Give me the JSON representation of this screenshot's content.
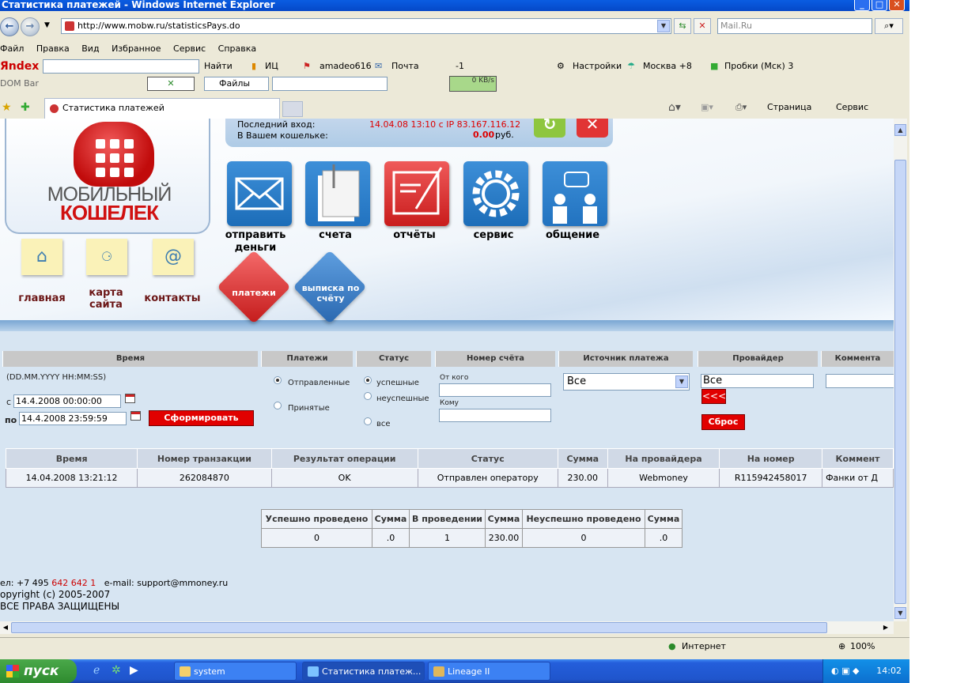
{
  "window": {
    "title": "Статистика платежей - Windows Internet Explorer"
  },
  "address": {
    "url": "http://www.mobw.ru/statisticsPays.do",
    "search_placeholder": "Mail.Ru"
  },
  "menu": [
    "Файл",
    "Правка",
    "Вид",
    "Избранное",
    "Сервис",
    "Справка"
  ],
  "toolbar1": {
    "brand": "Яndex",
    "find": "Найти",
    "ic": "ИЦ",
    "user": "amadeo616",
    "mail": "Почта",
    "minus": "-1",
    "settings": "Настройки",
    "moscow": "Москва +8",
    "traffic": "Пробки (Мск) 3"
  },
  "toolbar2": {
    "dom": "DOM Bar",
    "files": "Файлы",
    "speed": "0 KB/s"
  },
  "tab": {
    "title": "Статистика платежей"
  },
  "tabtools": {
    "page": "Страница",
    "service": "Сервис"
  },
  "login": {
    "last_label": "Последний вход:",
    "last_value": "14.04.08 13:10 с IP 83.167.116.12",
    "wallet_label": "В Вашем кошельке:",
    "balance": "0.00",
    "currency": "руб."
  },
  "logo": {
    "line1": "МОБИЛЬНЫЙ",
    "line2": "КОШЕЛЕК"
  },
  "icons": [
    {
      "label": "отправить деньги",
      "color": "#1c6db8"
    },
    {
      "label": "счета",
      "color": "#2273c0"
    },
    {
      "label": "отчёты",
      "color": "#d92e2e"
    },
    {
      "label": "сервис",
      "color": "#1c6db8"
    },
    {
      "label": "общение",
      "color": "#2273c0"
    }
  ],
  "nav": {
    "home": "главная",
    "sitemap": "карта сайта",
    "contacts": "контакты"
  },
  "diamonds": {
    "payments": "платежи",
    "statement": "выписка по счёту"
  },
  "filter": {
    "headers": [
      "Время",
      "Платежи",
      "Статус",
      "Номер счёта",
      "Источник платежа",
      "Провайдер",
      "Коммента"
    ],
    "format": "(DD.MM.YYYY HH:MM:SS)",
    "from_label": "с",
    "from": "14.4.2008 00:00:00",
    "to_label": "по",
    "to": "14.4.2008 23:59:59",
    "generate": "Сформировать",
    "payments": [
      "Отправленные",
      "Принятые"
    ],
    "status": [
      "успешные",
      "неуспешные",
      "все"
    ],
    "from_whom": "От кого",
    "to_whom": "Кому",
    "source": "Все",
    "provider": "Все",
    "back": "<<<",
    "reset": "Сброс"
  },
  "results": {
    "headers": [
      "Время",
      "Номер транзакции",
      "Результат операции",
      "Статус",
      "Сумма",
      "На провайдера",
      "На номер",
      "Коммент"
    ],
    "rows": [
      [
        "14.04.2008 13:21:12",
        "262084870",
        "OK",
        "Отправлен оператору",
        "230.00",
        "Webmoney",
        "R115942458017",
        "Фанки от Д"
      ]
    ]
  },
  "summary": {
    "headers": [
      "Успешно проведено",
      "Сумма",
      "В проведении",
      "Сумма",
      "Неуспешно проведено",
      "Сумма"
    ],
    "values": [
      "0",
      ".0",
      "1",
      "230.00",
      "0",
      ".0"
    ]
  },
  "footer": {
    "phone_label": "ел: +7 495",
    "phone": "642 642 1",
    "email": "e-mail: support@mmoney.ru",
    "copy": "opyright (c) 2005-2007",
    "rights": "ВСЕ ПРАВА ЗАЩИЩЕНЫ"
  },
  "statusbar": {
    "zone": "Интернет",
    "zoom": "100%"
  },
  "taskbar": {
    "start": "пуск",
    "tasks": [
      "system",
      "Статистика платеж...",
      "Lineage II"
    ],
    "time": "14:02"
  }
}
